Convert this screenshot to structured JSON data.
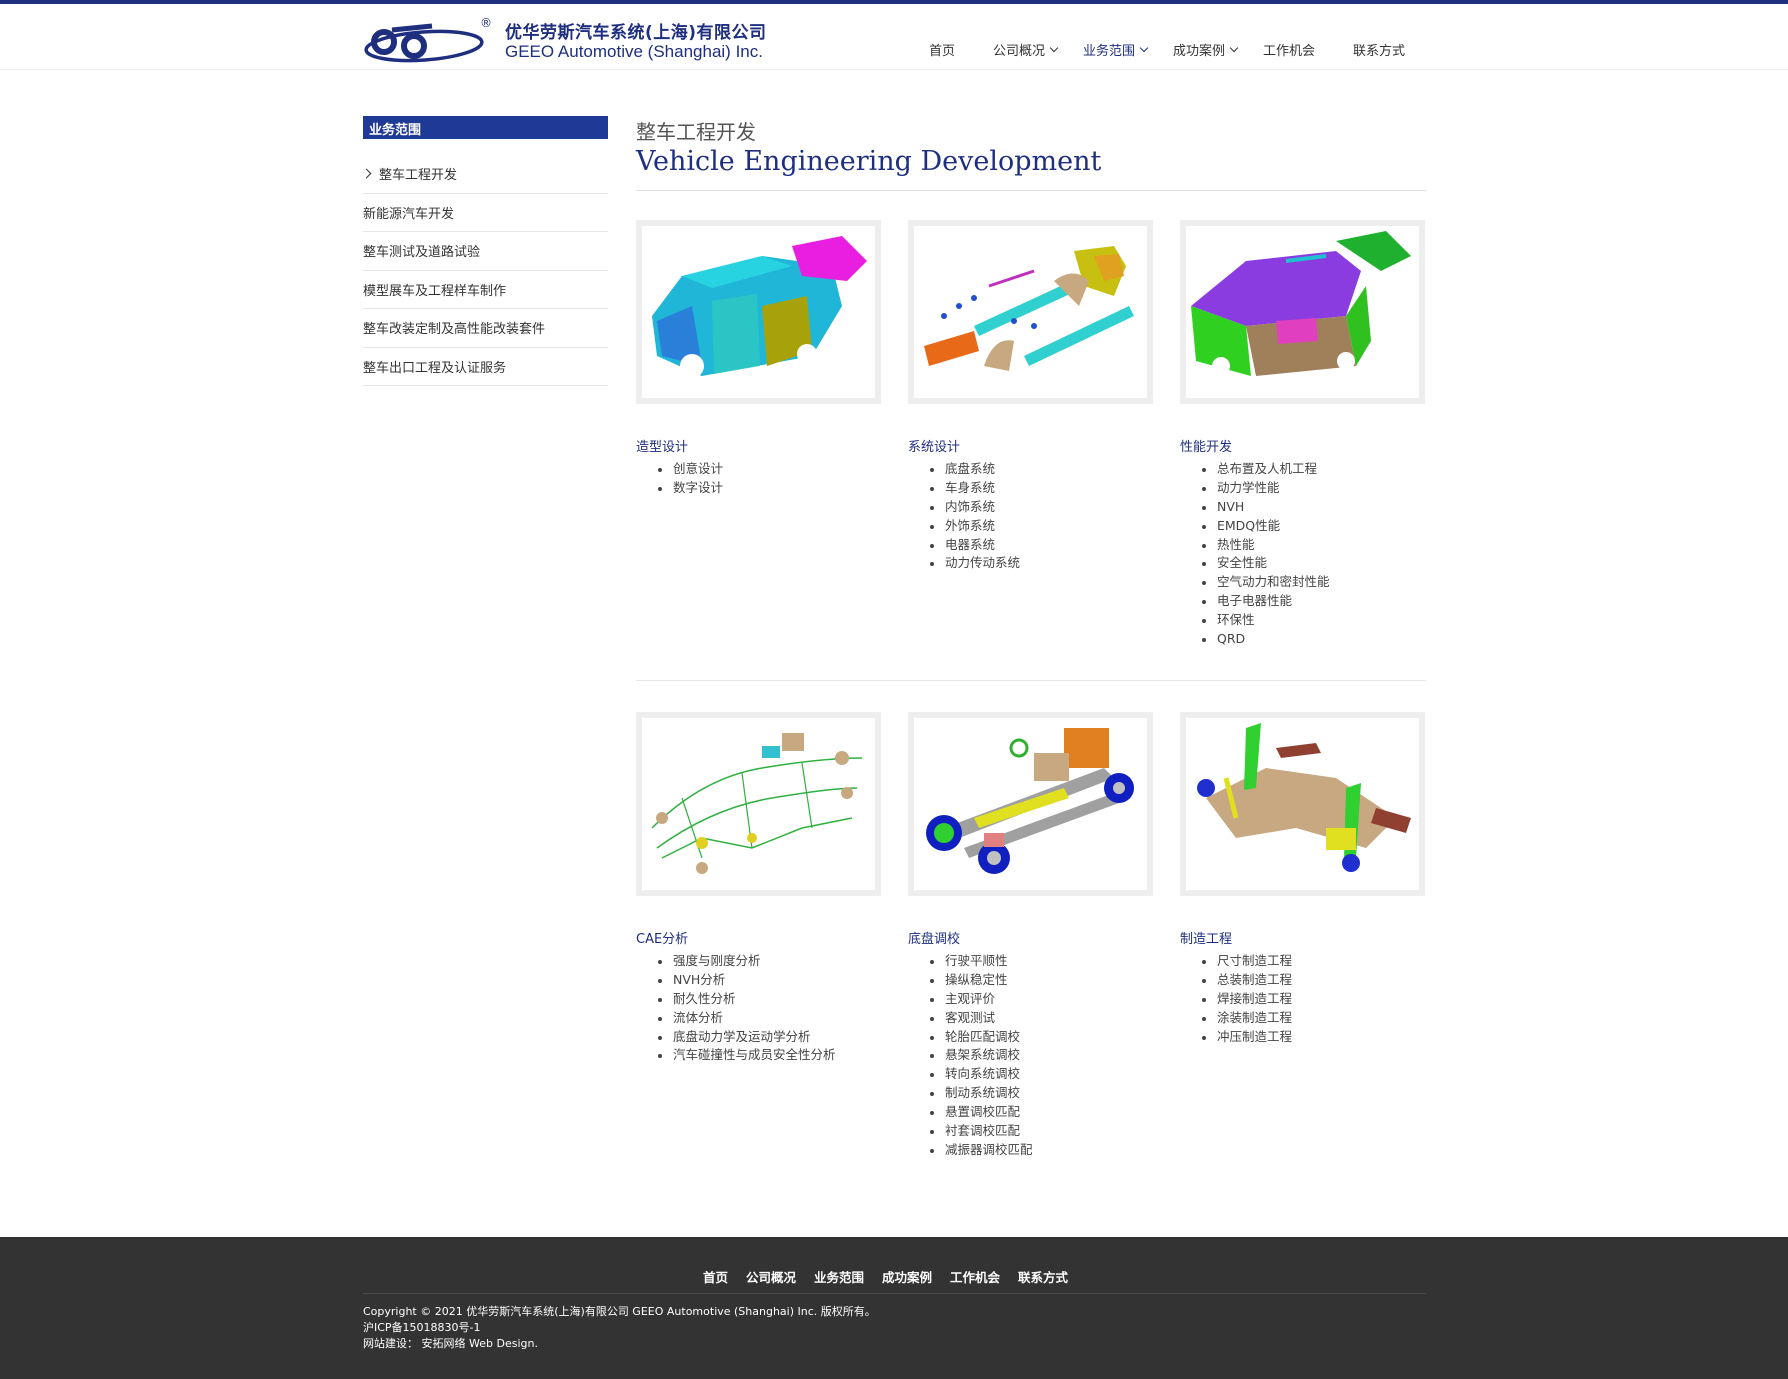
{
  "brand": {
    "name_cn": "优华劳斯汽车系统(上海)有限公司",
    "name_en": "GEEO Automotive (Shanghai) Inc.",
    "reg_mark": "®",
    "color": "#1f2f80"
  },
  "nav": {
    "items": [
      {
        "label": "首页"
      },
      {
        "label": "公司概况"
      },
      {
        "label": "业务范围"
      },
      {
        "label": "成功案例"
      },
      {
        "label": "工作机会"
      },
      {
        "label": "联系方式"
      }
    ]
  },
  "sidebar": {
    "title": "业务范围",
    "items": [
      {
        "label": "整车工程开发"
      },
      {
        "label": "新能源汽车开发"
      },
      {
        "label": "整车测试及道路试验"
      },
      {
        "label": "模型展车及工程样车制作"
      },
      {
        "label": "整车改装定制及高性能改装套件"
      },
      {
        "label": "整车出口工程及认证服务"
      }
    ]
  },
  "page": {
    "title_cn": "整车工程开发",
    "title_en": "Vehicle Engineering Development"
  },
  "cards": [
    {
      "title": "造型设计",
      "image": "body-in-white-render",
      "items": [
        "创意设计",
        "数字设计"
      ]
    },
    {
      "title": "系统设计",
      "image": "exploded-body-parts-render",
      "items": [
        "底盘系统",
        "车身系统",
        "内饰系统",
        "外饰系统",
        "电器系统",
        "动力传动系统"
      ]
    },
    {
      "title": "性能开发",
      "image": "vehicle-body-interior-render",
      "items": [
        "总布置及人机工程",
        "动力学性能",
        "NVH",
        "EMDQ性能",
        "热性能",
        "安全性能",
        "空气动力和密封性能",
        "电子电器性能",
        "环保性",
        "QRD"
      ]
    },
    {
      "title": "CAE分析",
      "image": "wiring-harness-render",
      "items": [
        "强度与刚度分析",
        "NVH分析",
        "耐久性分析",
        "流体分析",
        "底盘动力学及运动学分析",
        "汽车碰撞性与成员安全性分析"
      ]
    },
    {
      "title": "底盘调校",
      "image": "chassis-render",
      "items": [
        "行驶平顺性",
        "操纵稳定性",
        "主观评价",
        "客观测试",
        "轮胎匹配调校",
        "悬架系统调校",
        "转向系统调校",
        "制动系统调校",
        "悬置调校匹配",
        "衬套调校匹配",
        "减振器调校匹配"
      ]
    },
    {
      "title": "制造工程",
      "image": "suspension-subframe-render",
      "items": [
        "尺寸制造工程",
        "总装制造工程",
        "焊接制造工程",
        "涂装制造工程",
        "冲压制造工程"
      ]
    }
  ],
  "footer": {
    "nav": [
      "首页",
      "公司概况",
      "业务范围",
      "成功案例",
      "工作机会",
      "联系方式"
    ],
    "copyright": "Copyright © 2021 优华劳斯汽车系统(上海)有限公司 GEEO Automotive (Shanghai) Inc. 版权所有。",
    "icp": "沪ICP备15018830号-1",
    "credit": "网站建设： 安拓网络 Web Design."
  }
}
